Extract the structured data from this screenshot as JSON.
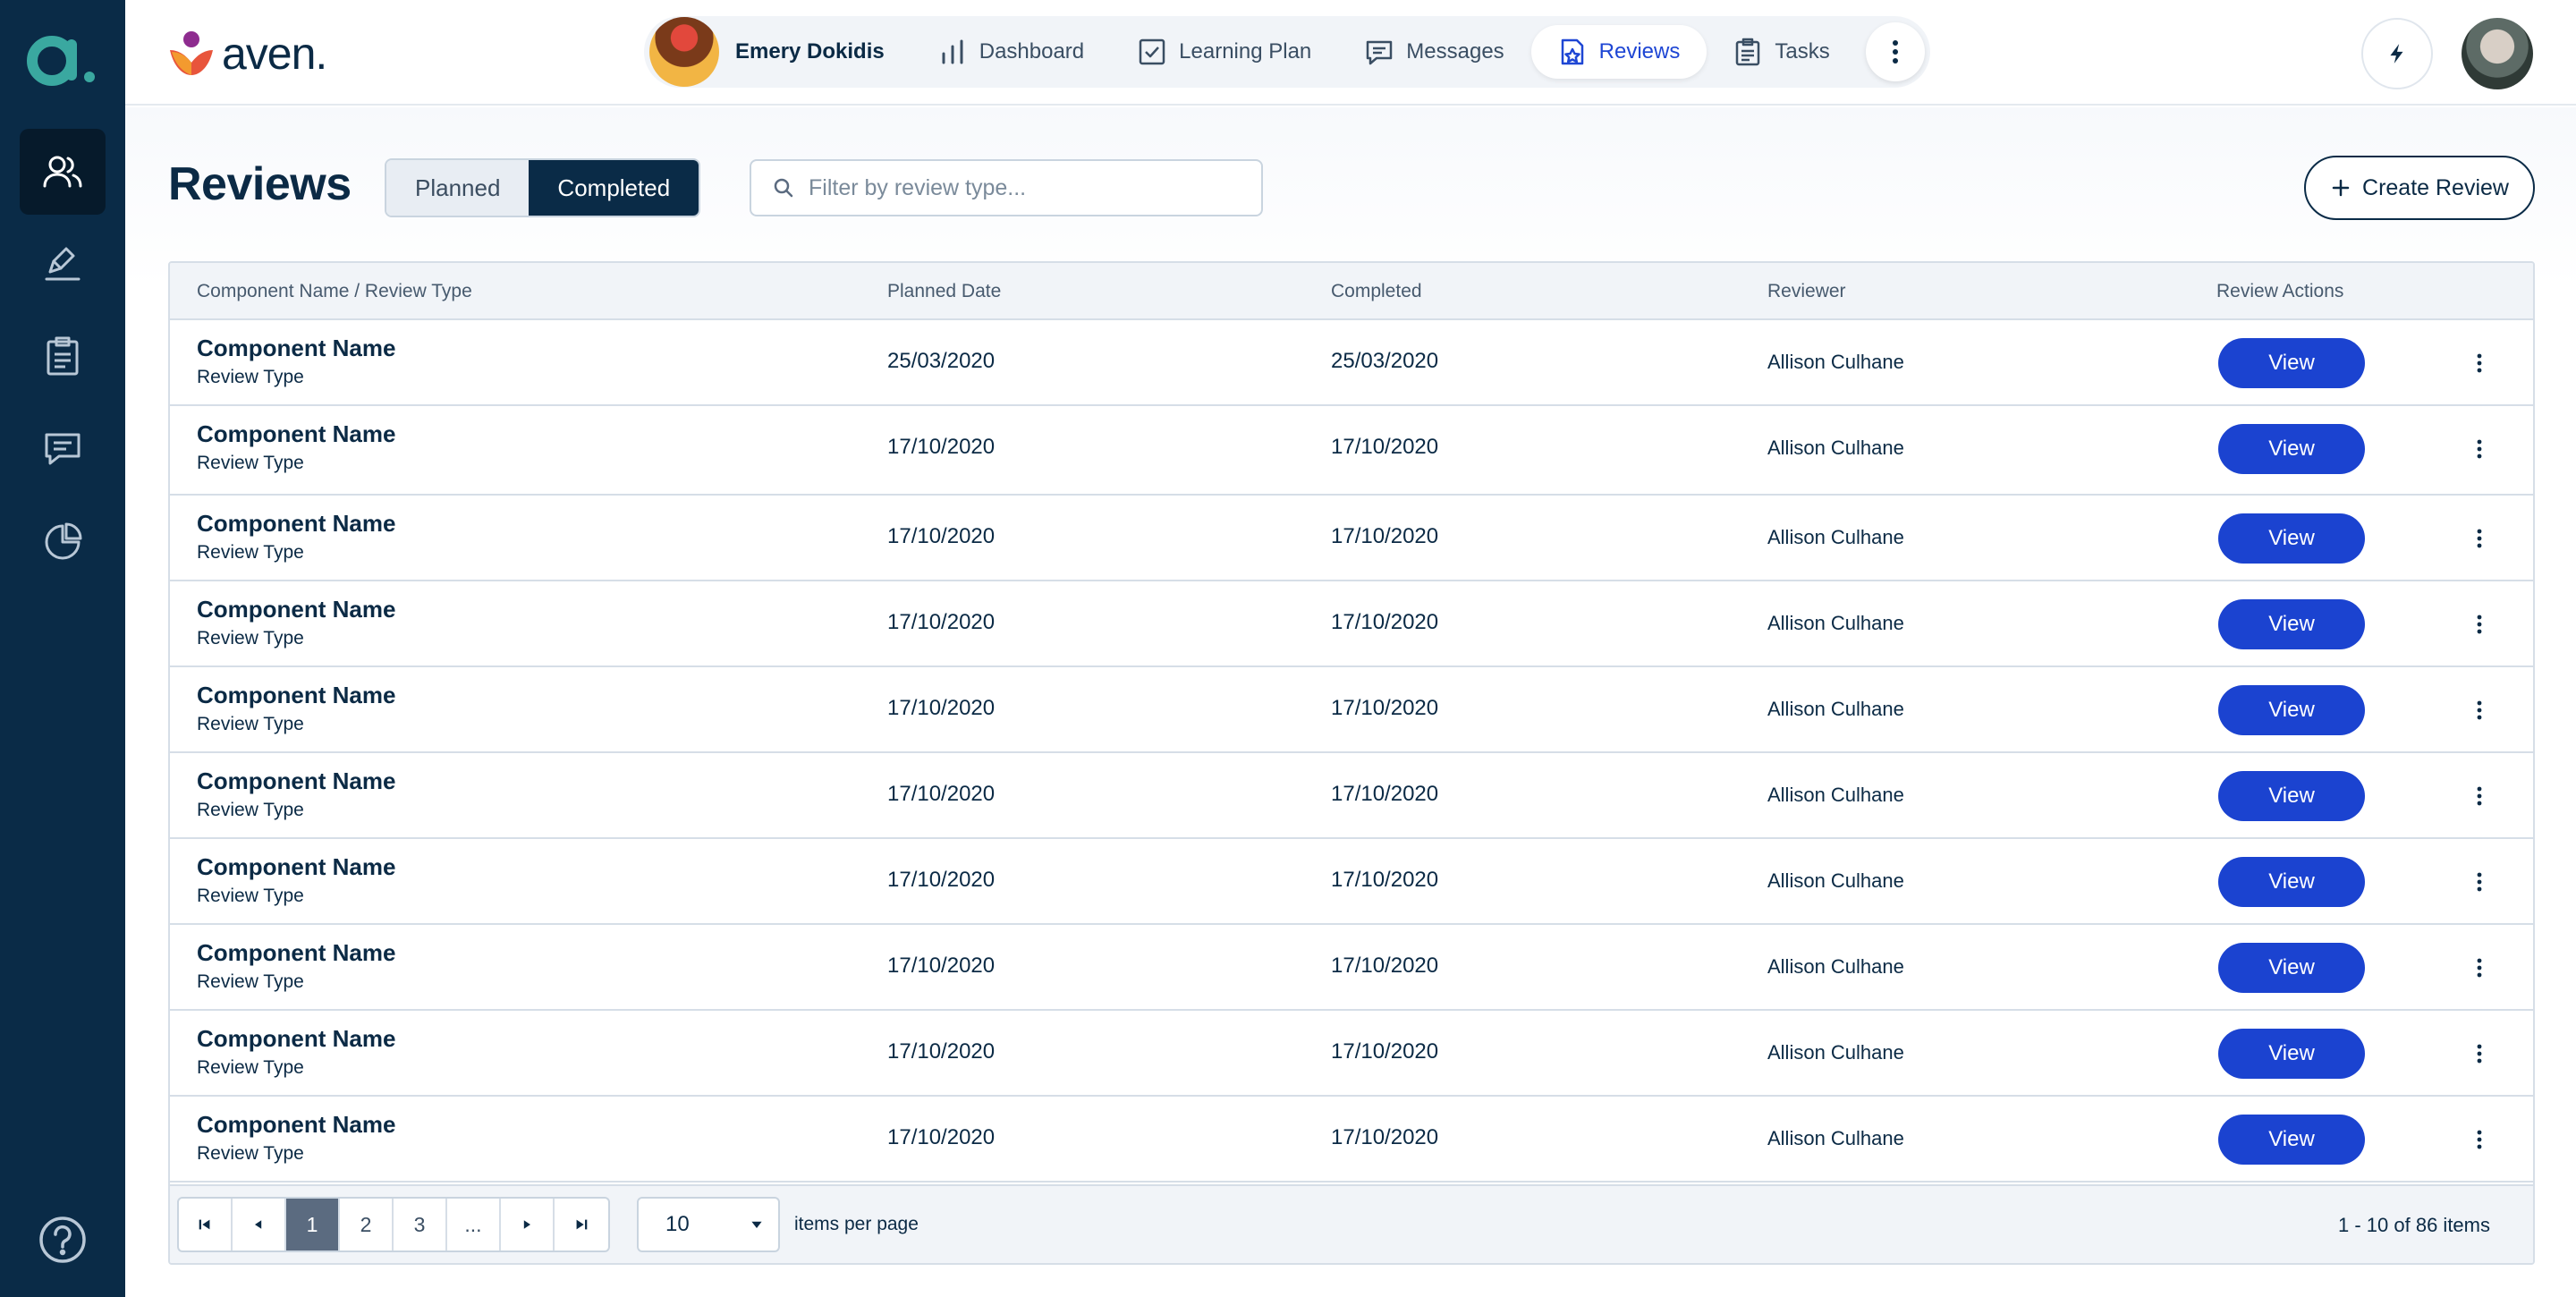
{
  "rail": {
    "items": [
      {
        "icon": "people-icon"
      },
      {
        "icon": "pen-icon"
      },
      {
        "icon": "clipboard-icon"
      },
      {
        "icon": "chat-icon"
      },
      {
        "icon": "pie-chart-icon"
      }
    ],
    "help_icon": "help-icon",
    "logo_letter": "a."
  },
  "brand": {
    "name": "aven."
  },
  "nav": {
    "user_name": "Emery Dokidis",
    "items": [
      {
        "label": "Dashboard",
        "icon": "bar-chart-icon"
      },
      {
        "label": "Learning Plan",
        "icon": "checkbox-icon"
      },
      {
        "label": "Messages",
        "icon": "message-icon"
      },
      {
        "label": "Reviews",
        "icon": "reviews-icon"
      },
      {
        "label": "Tasks",
        "icon": "tasks-icon"
      }
    ],
    "active": "Reviews"
  },
  "page": {
    "title": "Reviews",
    "tabs": [
      "Planned",
      "Completed"
    ],
    "active_tab": "Completed",
    "filter_placeholder": "Filter by review type...",
    "create_label": "Create Review"
  },
  "table": {
    "headers": [
      "Component Name / Review Type",
      "Planned Date",
      "Completed",
      "Reviewer",
      "Review Actions"
    ],
    "rows": [
      {
        "name": "Component Name",
        "type": "Review Type",
        "planned": "25/03/2020",
        "completed": "25/03/2020",
        "reviewer": "Allison Culhane",
        "action": "View"
      },
      {
        "name": "Component Name",
        "type": "Review Type",
        "planned": "17/10/2020",
        "completed": "17/10/2020",
        "reviewer": "Allison Culhane",
        "action": "View"
      },
      {
        "name": "Component Name",
        "type": "Review Type",
        "planned": "17/10/2020",
        "completed": "17/10/2020",
        "reviewer": "Allison Culhane",
        "action": "View"
      },
      {
        "name": "Component Name",
        "type": "Review Type",
        "planned": "17/10/2020",
        "completed": "17/10/2020",
        "reviewer": "Allison Culhane",
        "action": "View"
      },
      {
        "name": "Component Name",
        "type": "Review Type",
        "planned": "17/10/2020",
        "completed": "17/10/2020",
        "reviewer": "Allison Culhane",
        "action": "View"
      },
      {
        "name": "Component Name",
        "type": "Review Type",
        "planned": "17/10/2020",
        "completed": "17/10/2020",
        "reviewer": "Allison Culhane",
        "action": "View"
      },
      {
        "name": "Component Name",
        "type": "Review Type",
        "planned": "17/10/2020",
        "completed": "17/10/2020",
        "reviewer": "Allison Culhane",
        "action": "View"
      },
      {
        "name": "Component Name",
        "type": "Review Type",
        "planned": "17/10/2020",
        "completed": "17/10/2020",
        "reviewer": "Allison Culhane",
        "action": "View"
      },
      {
        "name": "Component Name",
        "type": "Review Type",
        "planned": "17/10/2020",
        "completed": "17/10/2020",
        "reviewer": "Allison Culhane",
        "action": "View"
      },
      {
        "name": "Component Name",
        "type": "Review Type",
        "planned": "17/10/2020",
        "completed": "17/10/2020",
        "reviewer": "Allison Culhane",
        "action": "View"
      }
    ]
  },
  "pagination": {
    "pages": [
      "1",
      "2",
      "3",
      "..."
    ],
    "current": "1",
    "per_page": "10",
    "per_page_label": "items per page",
    "info": "1 - 10 of 86 items"
  },
  "colors": {
    "rail": "#0a2b47",
    "accent": "#1b43d0",
    "brand_teal": "#3aa8a0"
  }
}
